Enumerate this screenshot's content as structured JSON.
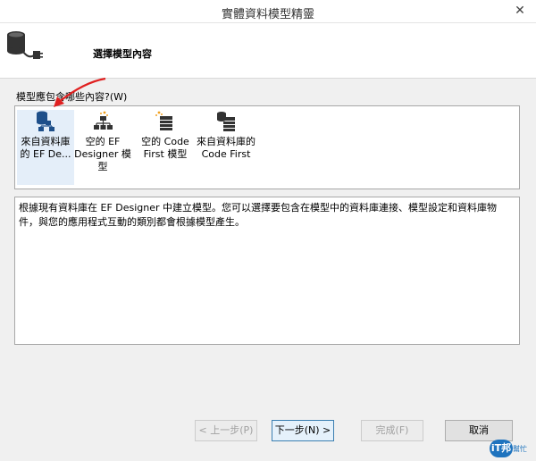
{
  "window": {
    "title": "實體資料模型精靈",
    "close_glyph": "✕"
  },
  "header": {
    "step_title": "選擇模型內容"
  },
  "prompt": {
    "label": "模型應包含哪些內容?(W)"
  },
  "options": [
    {
      "label": "來自資料庫\n的 EF De...",
      "icon": "database-model-icon",
      "selected": true
    },
    {
      "label": "空的 EF\nDesigner 模\n型",
      "icon": "empty-designer-model-icon",
      "selected": false
    },
    {
      "label": "空的 Code\nFirst 模型",
      "icon": "empty-code-first-icon",
      "selected": false
    },
    {
      "label": "來自資料庫的\nCode First",
      "icon": "code-first-from-db-icon",
      "selected": false
    }
  ],
  "description": {
    "text": "根據現有資料庫在 EF Designer 中建立模型。您可以選擇要包含在模型中的資料庫連接、模型設定和資料庫物件，與您的應用程式互動的類別都會根據模型產生。"
  },
  "buttons": {
    "previous": "< 上一步(P)",
    "next": "下一步(N) >",
    "finish": "完成(F)",
    "cancel": "取消"
  },
  "watermark": {
    "badge": "iT邦",
    "sub": "幫忙"
  },
  "colors": {
    "selection": "#e4eef9",
    "arrow": "#e02020",
    "accent": "#1e73be"
  }
}
